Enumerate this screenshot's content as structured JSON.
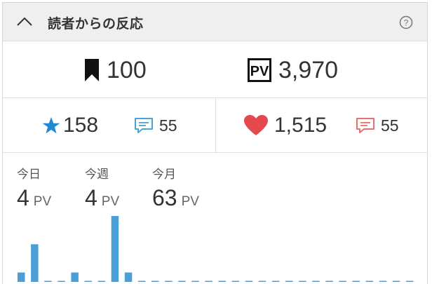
{
  "header": {
    "title": "読者からの反応"
  },
  "stats": {
    "bookmarks": "100",
    "pv_total": "3,970",
    "stars": "158",
    "star_comments": "55",
    "likes": "1,515",
    "like_comments": "55"
  },
  "pv": {
    "today_label": "今日",
    "today_value": "4",
    "today_unit": "PV",
    "week_label": "今週",
    "week_value": "4",
    "week_unit": "PV",
    "month_label": "今月",
    "month_value": "63",
    "month_unit": "PV"
  },
  "colors": {
    "star": "#1e88d4",
    "heart": "#e5484d",
    "bar": "#4a9fd8"
  },
  "chart_data": {
    "type": "bar",
    "values": [
      1,
      4,
      0,
      0,
      1,
      0,
      0,
      7,
      1,
      0,
      0,
      0,
      0,
      0,
      0,
      0,
      0,
      0,
      0,
      0,
      0,
      0,
      0,
      0,
      0,
      0,
      0,
      0,
      0,
      0
    ],
    "ylim": [
      0,
      7
    ]
  }
}
